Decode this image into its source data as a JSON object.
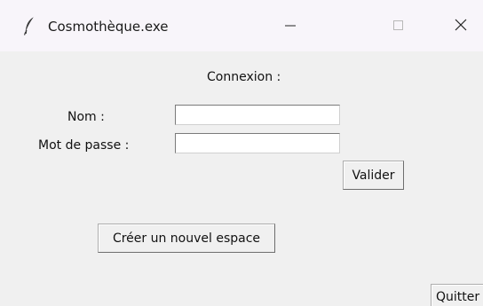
{
  "window": {
    "title": "Cosmothèque.exe",
    "app_icon": "feather-icon",
    "controls": {
      "minimize_icon": "minimize-icon",
      "maximize_icon": "maximize-icon",
      "close_icon": "close-icon"
    }
  },
  "form": {
    "heading": "Connexion :",
    "nom_label": "Nom :",
    "nom_value": "",
    "password_label": "Mot de passe :",
    "password_value": "",
    "validate_label": "Valider",
    "create_space_label": "Créer un nouvel espace",
    "quit_label": "Quitter"
  }
}
